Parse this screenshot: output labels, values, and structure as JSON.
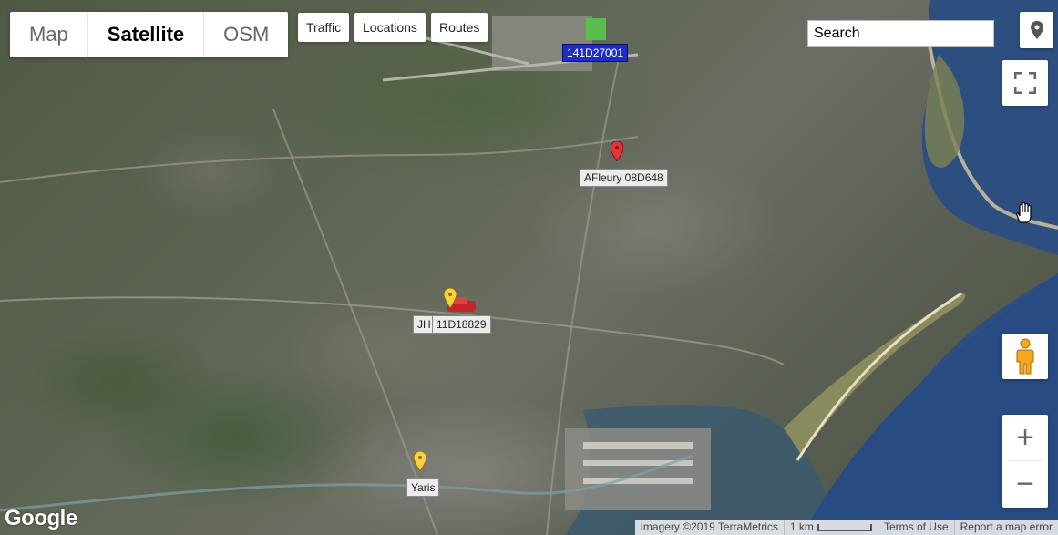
{
  "map_types": {
    "items": [
      {
        "label": "Map",
        "active": false
      },
      {
        "label": "Satellite",
        "active": true
      },
      {
        "label": "OSM",
        "active": false
      }
    ]
  },
  "layers": {
    "traffic": "Traffic",
    "locations": "Locations",
    "routes": "Routes"
  },
  "search": {
    "value": "Search"
  },
  "icons": {
    "pin": "map-pin-icon",
    "fullscreen": "fullscreen-icon",
    "pegman": "street-view-pegman-icon",
    "zoom_in": "plus-icon",
    "zoom_out": "minus-icon",
    "cursor": "hand-cursor-icon"
  },
  "zoom": {
    "in": "+",
    "out": "−"
  },
  "vehicles": {
    "v1": "141D27001",
    "v2": "AFleury 08D648",
    "v3a": "JH",
    "v3b": "11D18829",
    "v4": "Yaris"
  },
  "branding": {
    "logo": "Google"
  },
  "footer": {
    "imagery": "Imagery ©2019 TerraMetrics",
    "scale": "1 km",
    "terms": "Terms of Use",
    "report": "Report a map error"
  },
  "colors": {
    "water": "#2d4f7f",
    "marker_red": "#e8333a",
    "marker_yellow": "#f6d23c",
    "vehicle_label_blue": "#1f2dc8"
  }
}
